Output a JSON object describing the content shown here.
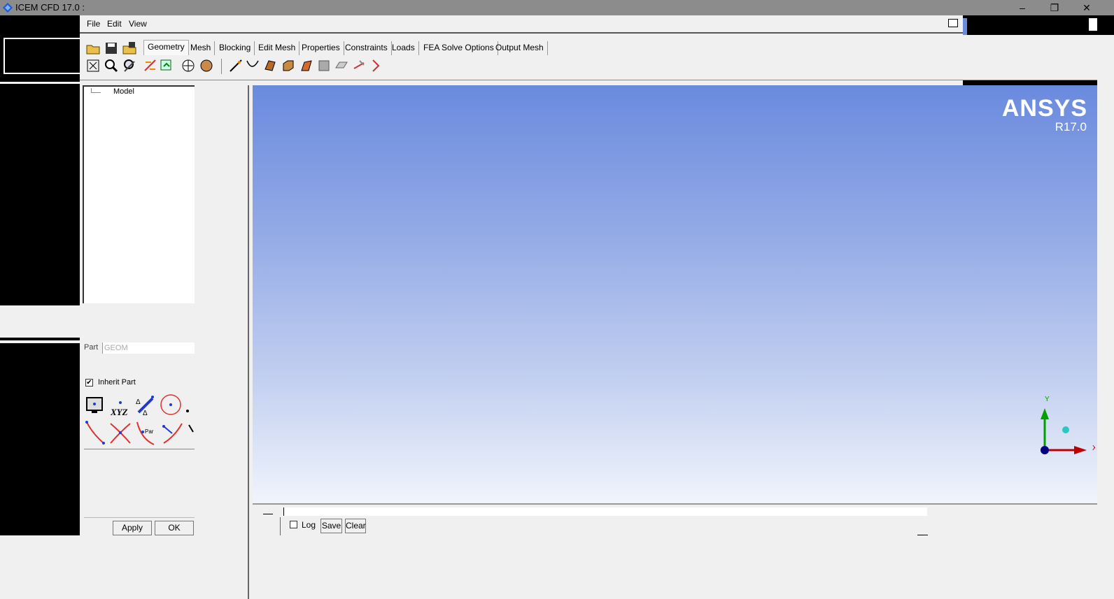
{
  "window": {
    "title": "ICEM CFD 17.0 :",
    "minimize": "–",
    "maximize": "❐",
    "close": "✕"
  },
  "menu": {
    "items": [
      "File",
      "Edit",
      "View"
    ]
  },
  "tabs": [
    "Geometry",
    "Mesh",
    "Blocking",
    "Edit Mesh",
    "Properties",
    "Constraints",
    "Loads",
    "FEA Solve Options",
    "Output Mesh"
  ],
  "active_tab": "Geometry",
  "tree": {
    "root": "Model"
  },
  "panel": {
    "part_label": "Part",
    "part_value": "GEOM",
    "inherit_label": "Inherit Part",
    "inherit_checked": "✔",
    "xyz_label": "XYZ",
    "apply": "Apply",
    "ok": "OK"
  },
  "viewport": {
    "brand": "ANSYS",
    "version": "R17.0",
    "axis_y": "Y",
    "axis_x": "X"
  },
  "messages": {
    "log_label": "Log",
    "save": "Save",
    "clear": "Clear"
  },
  "colors": {
    "accent": "#6a8ade",
    "axis_x": "#c00000",
    "axis_y": "#00a000",
    "axis_z": "#000080"
  }
}
